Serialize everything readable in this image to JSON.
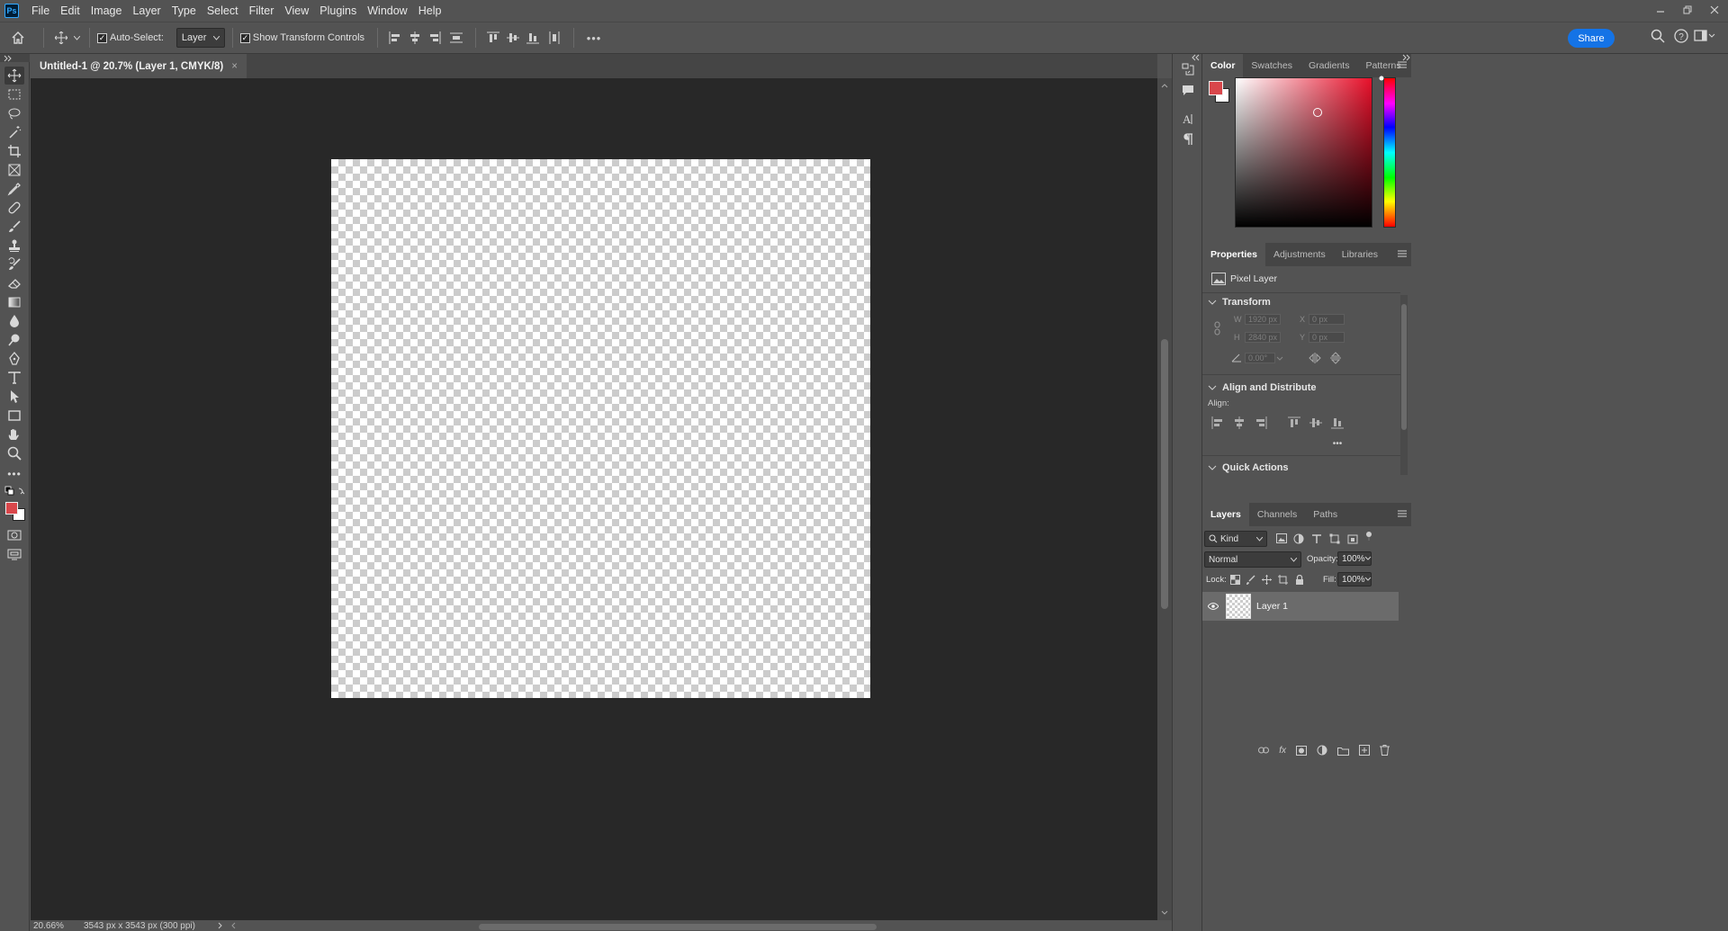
{
  "app": {
    "logo": "Ps"
  },
  "menu": [
    "File",
    "Edit",
    "Image",
    "Layer",
    "Type",
    "Select",
    "Filter",
    "View",
    "Plugins",
    "Window",
    "Help"
  ],
  "options": {
    "auto_select_label": "Auto-Select:",
    "auto_select_target": "Layer",
    "show_transform_label": "Show Transform Controls",
    "share_label": "Share",
    "more": "•••"
  },
  "document": {
    "tab_title": "Untitled-1 @ 20.7% (Layer 1, CMYK/8)",
    "close_glyph": "×",
    "zoom": "20.66%",
    "doc_info": "3543 px x 3543 px (300 ppi)"
  },
  "color_panel": {
    "tabs": [
      "Color",
      "Swatches",
      "Gradients",
      "Patterns"
    ],
    "foreground": "#d9474b",
    "background": "#ffffff"
  },
  "properties_panel": {
    "tabs": [
      "Properties",
      "Adjustments",
      "Libraries"
    ],
    "layer_type": "Pixel Layer",
    "transform_title": "Transform",
    "w_label": "W",
    "w_value": "1920 px",
    "h_label": "H",
    "h_value": "2840 px",
    "x_label": "X",
    "x_value": "0 px",
    "y_label": "Y",
    "y_value": "0 px",
    "angle_value": "0.00°",
    "align_title": "Align and Distribute",
    "align_label": "Align:",
    "quick_actions_title": "Quick Actions",
    "more": "•••"
  },
  "layers_panel": {
    "tabs": [
      "Layers",
      "Channels",
      "Paths"
    ],
    "filter_kind": "Kind",
    "blend_mode": "Normal",
    "opacity_label": "Opacity:",
    "opacity_value": "100%",
    "lock_label": "Lock:",
    "fill_label": "Fill:",
    "fill_value": "100%",
    "layers": [
      {
        "name": "Layer 1",
        "visible": true,
        "selected": true
      }
    ]
  },
  "colors": {
    "chrome": "#535353",
    "canvas_bg": "#282828",
    "accent": "#1473e6"
  }
}
